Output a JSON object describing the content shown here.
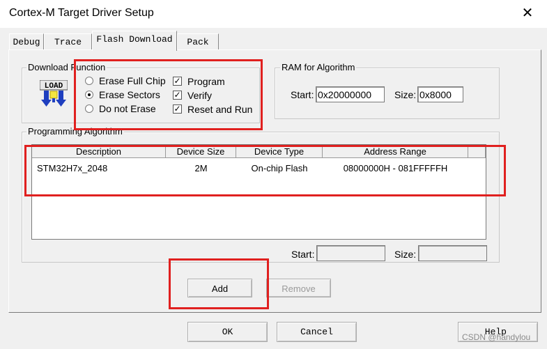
{
  "window": {
    "title": "Cortex-M Target Driver Setup",
    "close_glyph": "✕"
  },
  "tabs": [
    {
      "label": "Debug"
    },
    {
      "label": "Trace"
    },
    {
      "label": "Flash Download",
      "active": true
    },
    {
      "label": "Pack"
    }
  ],
  "download_function": {
    "legend": "Download Function",
    "radios": [
      {
        "label": "Erase Full Chip",
        "checked": false
      },
      {
        "label": "Erase Sectors",
        "checked": true
      },
      {
        "label": "Do not Erase",
        "checked": false
      }
    ],
    "checks": [
      {
        "label": "Program",
        "checked": true
      },
      {
        "label": "Verify",
        "checked": true
      },
      {
        "label": "Reset and Run",
        "checked": true
      }
    ],
    "load_icon": "load-icon",
    "load_text": "LOAD"
  },
  "ram": {
    "legend": "RAM for Algorithm",
    "start_label": "Start:",
    "start_value": "0x20000000",
    "size_label": "Size:",
    "size_value": "0x8000"
  },
  "programming": {
    "legend": "Programming Algorithm",
    "columns": [
      "Description",
      "Device Size",
      "Device Type",
      "Address Range"
    ],
    "rows": [
      {
        "description": "STM32H7x_2048",
        "size": "2M",
        "type": "On-chip Flash",
        "range": "08000000H - 081FFFFFH"
      }
    ],
    "start_label": "Start:",
    "start_value": "",
    "size_label": "Size:",
    "size_value": ""
  },
  "buttons": {
    "add": "Add",
    "remove": "Remove",
    "ok": "OK",
    "cancel": "Cancel",
    "help": "Help"
  },
  "watermark": "CSDN @handylou",
  "colors": {
    "annotation": "#e0201f",
    "dialog_bg": "#f0f0f0"
  }
}
